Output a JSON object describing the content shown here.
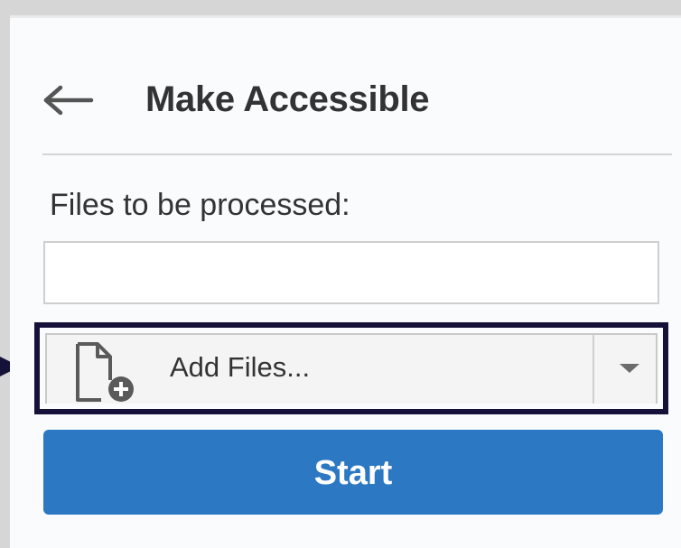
{
  "panel": {
    "title": "Make Accessible",
    "back_icon": "arrow-left-icon"
  },
  "files": {
    "label": "Files to be processed:",
    "list_value": ""
  },
  "add_files": {
    "label": "Add Files...",
    "icon": "add-file-icon",
    "dropdown_icon": "caret-down-icon"
  },
  "start": {
    "label": "Start"
  },
  "colors": {
    "accent": "#2c78c3",
    "highlight_border": "#15123a",
    "text": "#333333"
  }
}
